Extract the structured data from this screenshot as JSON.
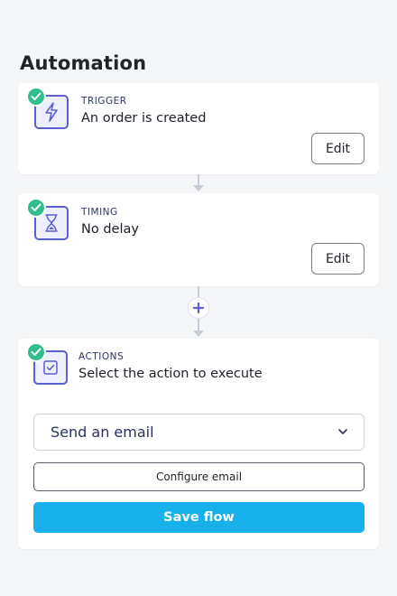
{
  "page": {
    "title": "Automation"
  },
  "steps": {
    "trigger": {
      "label": "TRIGGER",
      "text": "An order is created",
      "edit_label": "Edit",
      "icon": "lightning-icon"
    },
    "timing": {
      "label": "TIMING",
      "text": "No delay",
      "edit_label": "Edit",
      "icon": "hourglass-icon"
    },
    "actions": {
      "label": "ACTIONS",
      "text": "Select the action to execute",
      "icon": "checkbox-icon",
      "select_value": "Send an email",
      "configure_label": "Configure email",
      "save_label": "Save flow"
    }
  },
  "colors": {
    "accent": "#17b0ea",
    "check": "#2fbf8f",
    "icon_border": "#5b5fcf",
    "connector": "#c9ccd6"
  }
}
